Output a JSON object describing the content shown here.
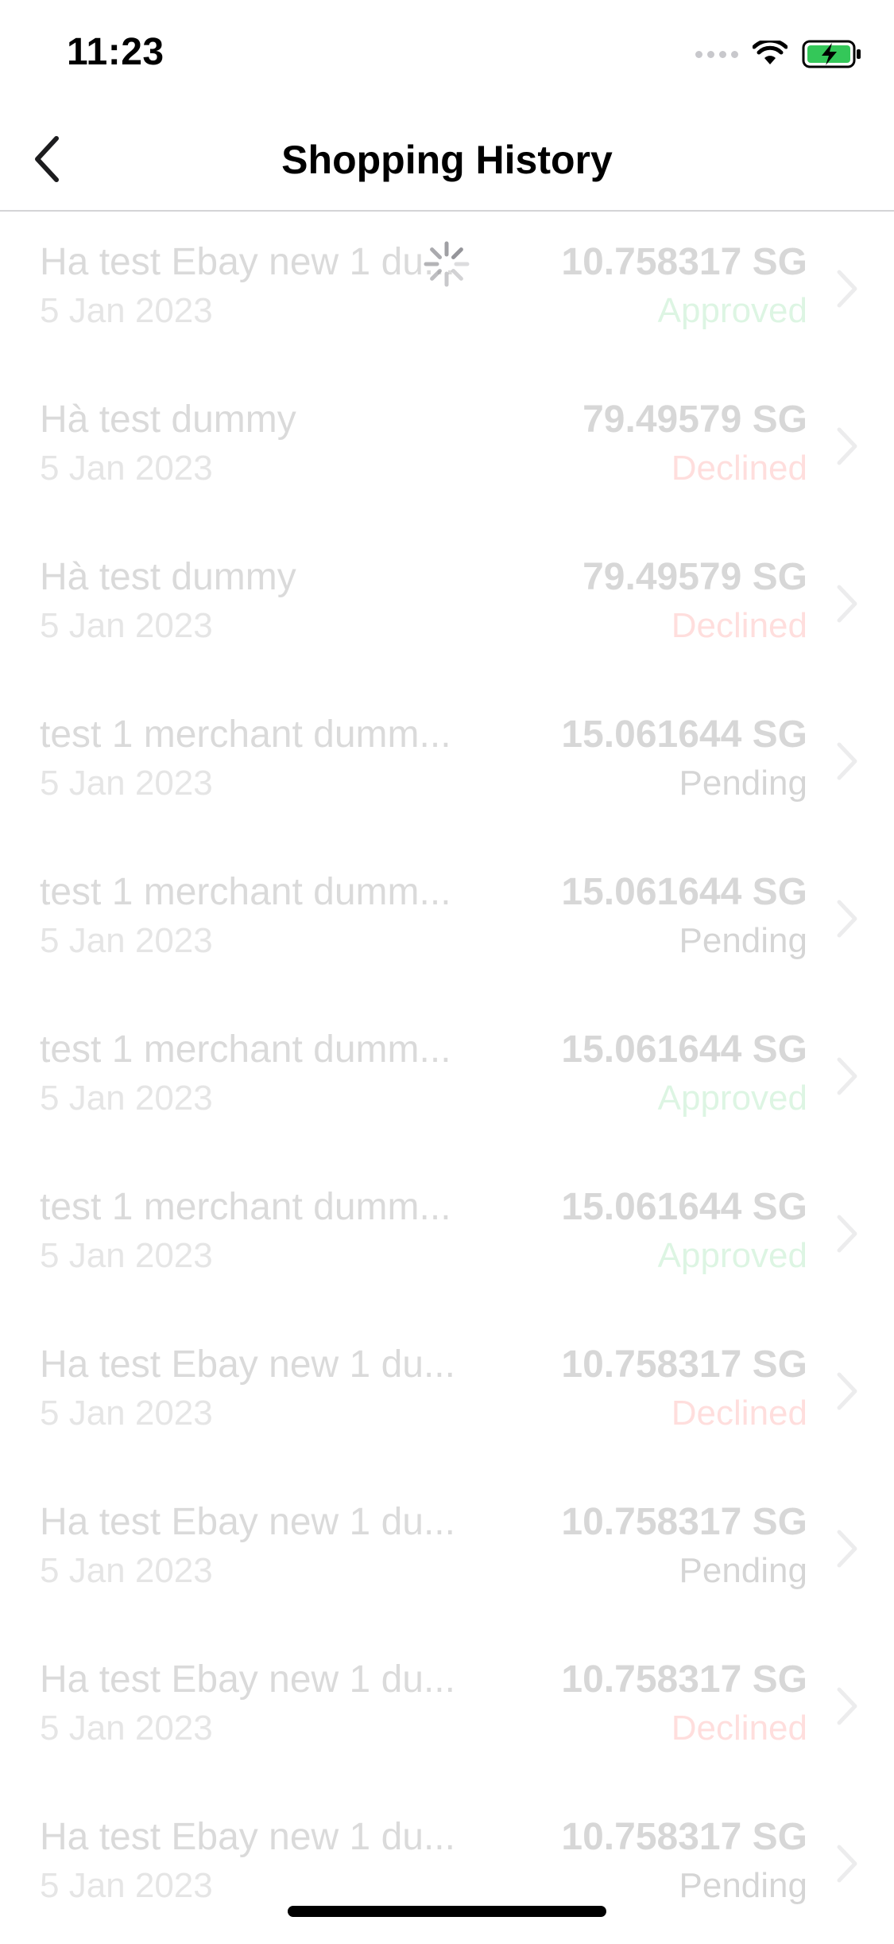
{
  "status_bar": {
    "time": "11:23"
  },
  "nav": {
    "title": "Shopping History",
    "back_icon": "chevron-left-icon"
  },
  "colors": {
    "approved": "#34c759",
    "declined": "#ff3b30",
    "pending": "#000000"
  },
  "purchases": [
    {
      "name": "Ha test Ebay new 1 du...",
      "date": "5 Jan 2023",
      "amount": "10.758317 SG",
      "status": "Approved",
      "status_key": "approved"
    },
    {
      "name": "Hà test dummy",
      "date": "5 Jan 2023",
      "amount": "79.49579 SG",
      "status": "Declined",
      "status_key": "declined"
    },
    {
      "name": "Hà test dummy",
      "date": "5 Jan 2023",
      "amount": "79.49579 SG",
      "status": "Declined",
      "status_key": "declined"
    },
    {
      "name": "test 1 merchant dumm...",
      "date": "5 Jan 2023",
      "amount": "15.061644 SG",
      "status": "Pending",
      "status_key": "pending"
    },
    {
      "name": "test 1 merchant dumm...",
      "date": "5 Jan 2023",
      "amount": "15.061644 SG",
      "status": "Pending",
      "status_key": "pending"
    },
    {
      "name": "test 1 merchant dumm...",
      "date": "5 Jan 2023",
      "amount": "15.061644 SG",
      "status": "Approved",
      "status_key": "approved"
    },
    {
      "name": "test 1 merchant dumm...",
      "date": "5 Jan 2023",
      "amount": "15.061644 SG",
      "status": "Approved",
      "status_key": "approved"
    },
    {
      "name": "Ha test Ebay new 1 du...",
      "date": "5 Jan 2023",
      "amount": "10.758317 SG",
      "status": "Declined",
      "status_key": "declined"
    },
    {
      "name": "Ha test Ebay new 1 du...",
      "date": "5 Jan 2023",
      "amount": "10.758317 SG",
      "status": "Pending",
      "status_key": "pending"
    },
    {
      "name": "Ha test Ebay new 1 du...",
      "date": "5 Jan 2023",
      "amount": "10.758317 SG",
      "status": "Declined",
      "status_key": "declined"
    },
    {
      "name": "Ha test Ebay new 1 du...",
      "date": "5 Jan 2023",
      "amount": "10.758317 SG",
      "status": "Pending",
      "status_key": "pending"
    }
  ]
}
